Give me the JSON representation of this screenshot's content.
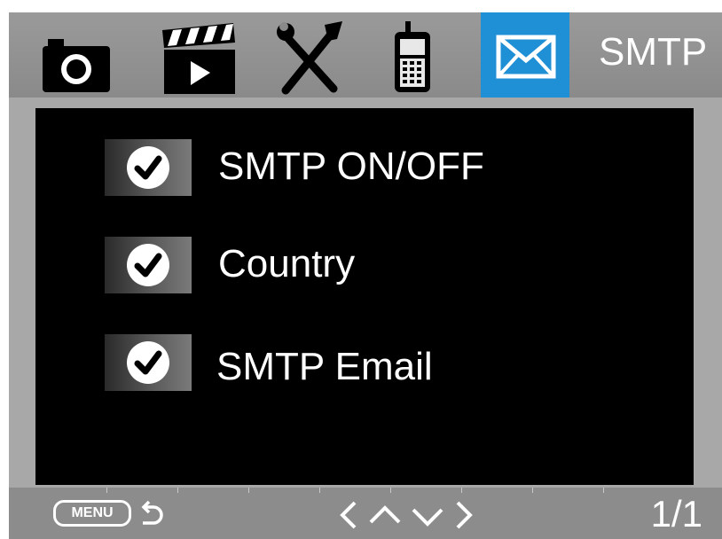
{
  "header": {
    "title": "SMTP",
    "tabs": [
      {
        "icon": "camera-icon",
        "active": false
      },
      {
        "icon": "video-clapper-icon",
        "active": false
      },
      {
        "icon": "tools-icon",
        "active": false
      },
      {
        "icon": "cellular-device-icon",
        "active": false
      },
      {
        "icon": "envelope-icon",
        "active": true
      }
    ],
    "active_color": "#1f8fd6"
  },
  "menu": {
    "items": [
      {
        "label": "SMTP ON/OFF",
        "checked": true
      },
      {
        "label": "Country",
        "checked": true
      },
      {
        "label": "SMTP Email",
        "checked": true
      }
    ]
  },
  "footer": {
    "menu_label": "MENU",
    "back_icon": "back-arrow-icon",
    "nav_icons": [
      "left-arrow-icon",
      "up-arrow-icon",
      "down-arrow-icon",
      "right-arrow-icon"
    ],
    "page": "1/1"
  }
}
